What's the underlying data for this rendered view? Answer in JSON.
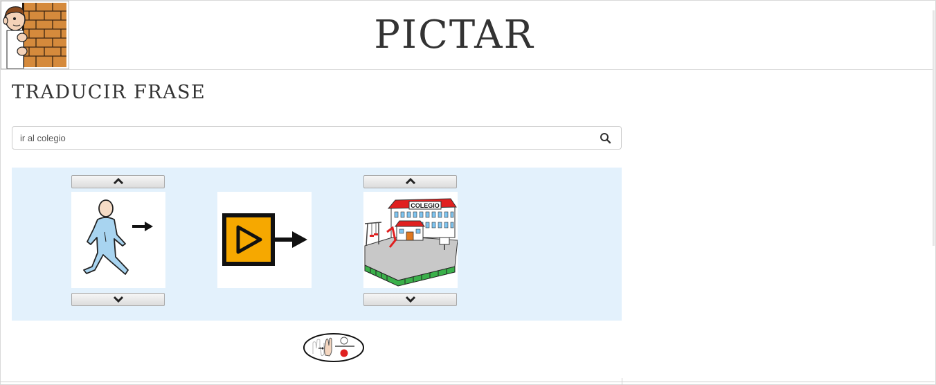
{
  "header": {
    "title": "PICTAR",
    "logo_icon": "peeking-boy-behind-brick-wall-icon"
  },
  "translate": {
    "heading": "Traducir frase",
    "search": {
      "value": "ir al colegio",
      "button_icon": "search-icon"
    }
  },
  "result": {
    "words": [
      {
        "pictogram": "walking-person-arrow-icon",
        "has_up": true,
        "has_down": true
      },
      {
        "pictogram": "play-arrow-verb-icon",
        "has_up": false,
        "has_down": false
      },
      {
        "pictogram": "colegio-school-building-icon",
        "has_up": true,
        "has_down": true,
        "image_text": "COLEGIO"
      }
    ],
    "sign_language_icon": "sign-language-hands-icon"
  },
  "colors": {
    "panel_bg": "#e3f1fc",
    "title_text": "#333333",
    "verb_orange": "#f6a800",
    "school_roof": "#e02020"
  }
}
